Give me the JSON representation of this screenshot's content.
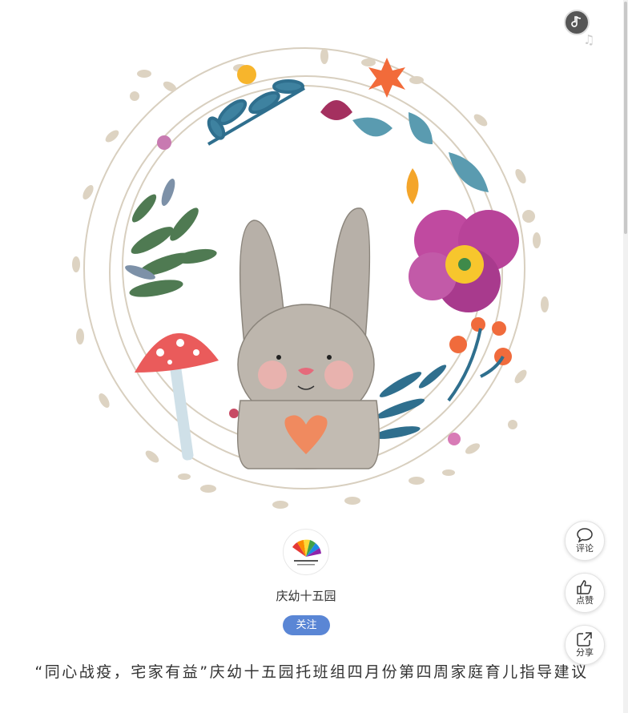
{
  "author": {
    "name": "庆幼十五园",
    "follow_label": "关注"
  },
  "article": {
    "title": "“同心战疫，宅家有益”庆幼十五园托班组四月份第四周家庭育儿指导建议"
  },
  "side_actions": {
    "comment": "评论",
    "like": "点赞",
    "share": "分享"
  },
  "music": {
    "icon": "music-disc-icon",
    "note": "♫"
  },
  "colors": {
    "follow_button": "#5a86d5",
    "text": "#333333",
    "wreath": "#d8cfbf"
  }
}
